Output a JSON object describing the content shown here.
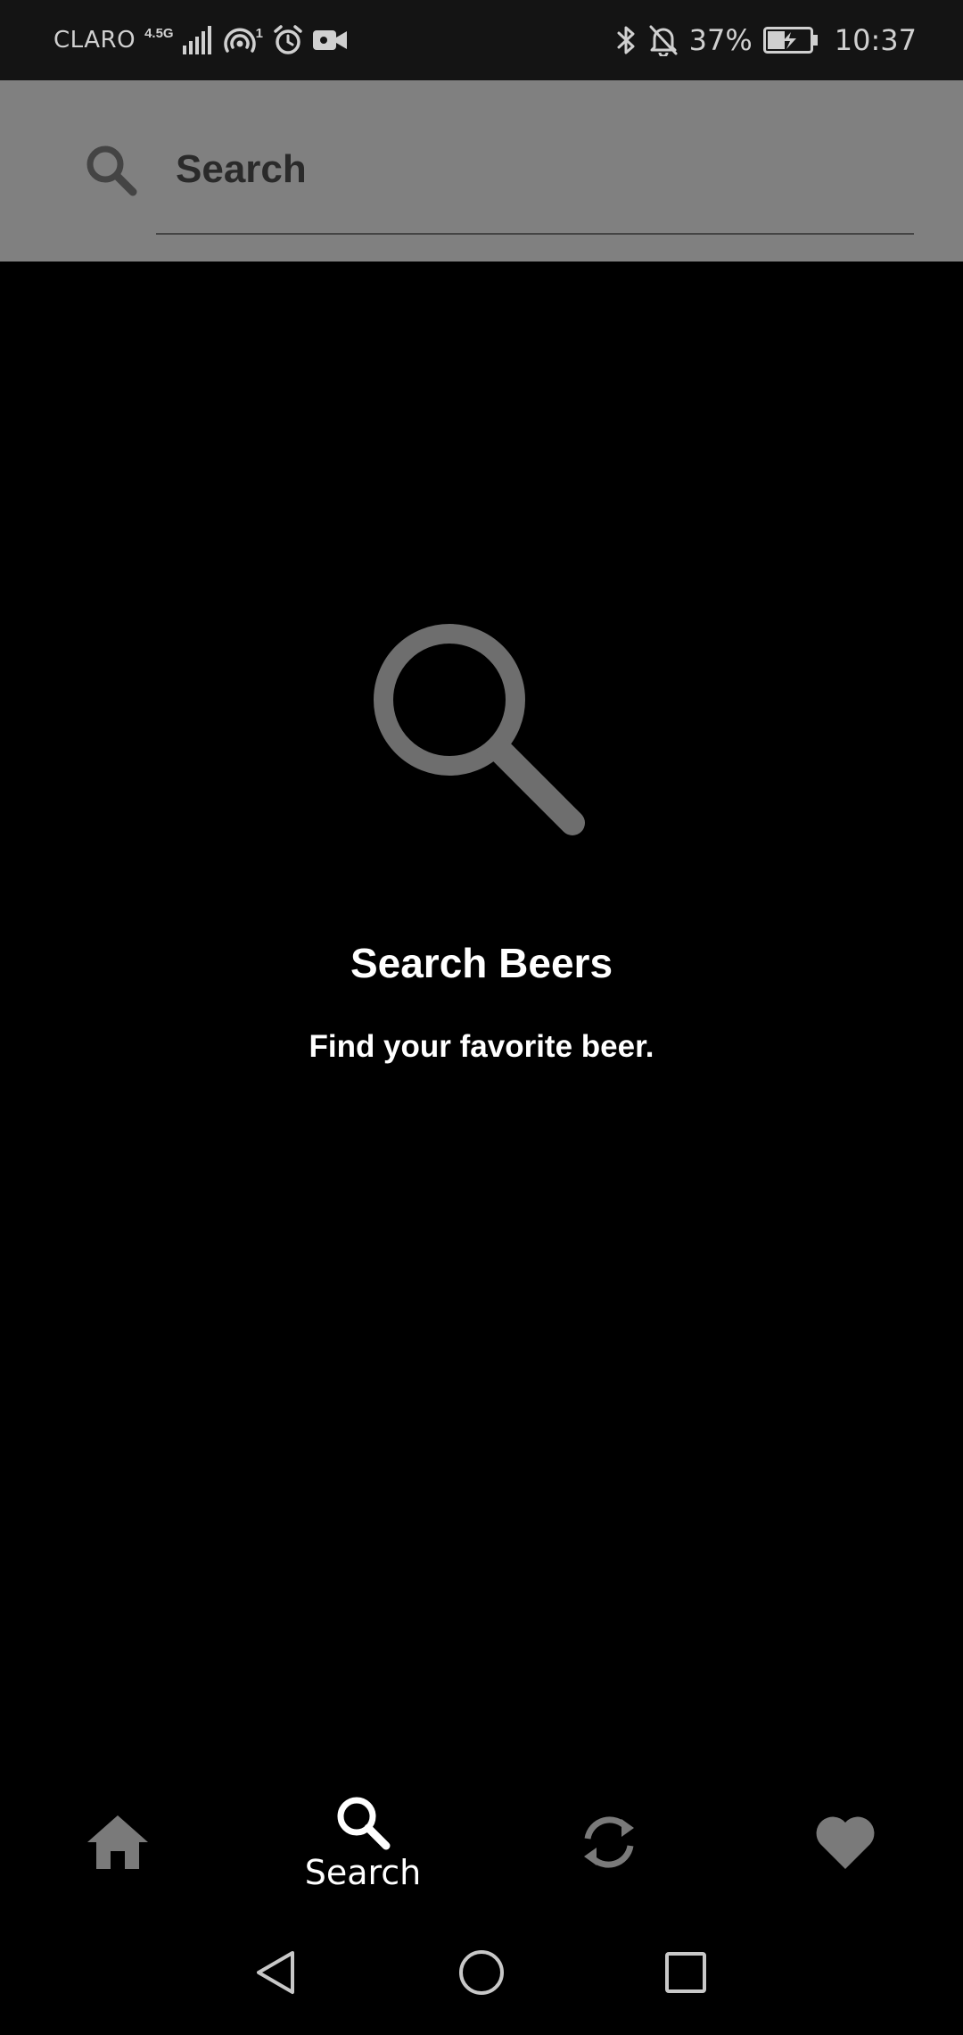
{
  "status_bar": {
    "carrier": "CLARO",
    "network_type": "4.5G",
    "hotspot_count": "1",
    "battery_percent": "37%",
    "time": "10:37",
    "icons": [
      "signal-icon",
      "hotspot-icon",
      "alarm-icon",
      "video-icon",
      "bluetooth-icon",
      "mute-bell-icon",
      "battery-charging-icon"
    ]
  },
  "search": {
    "placeholder": "Search",
    "value": ""
  },
  "empty_state": {
    "icon": "search-icon",
    "title": "Search Beers",
    "subtitle": "Find your favorite beer."
  },
  "bottom_nav": {
    "items": [
      {
        "icon": "home-icon",
        "label": "",
        "active": false
      },
      {
        "icon": "search-icon",
        "label": "Search",
        "active": true
      },
      {
        "icon": "refresh-icon",
        "label": "",
        "active": false
      },
      {
        "icon": "heart-icon",
        "label": "",
        "active": false
      }
    ]
  },
  "colors": {
    "background": "#000000",
    "header": "#808080",
    "status_bar": "#141414",
    "inactive_icon": "#7a7a7a",
    "active_icon": "#ffffff",
    "empty_icon": "#6e6e6e"
  }
}
